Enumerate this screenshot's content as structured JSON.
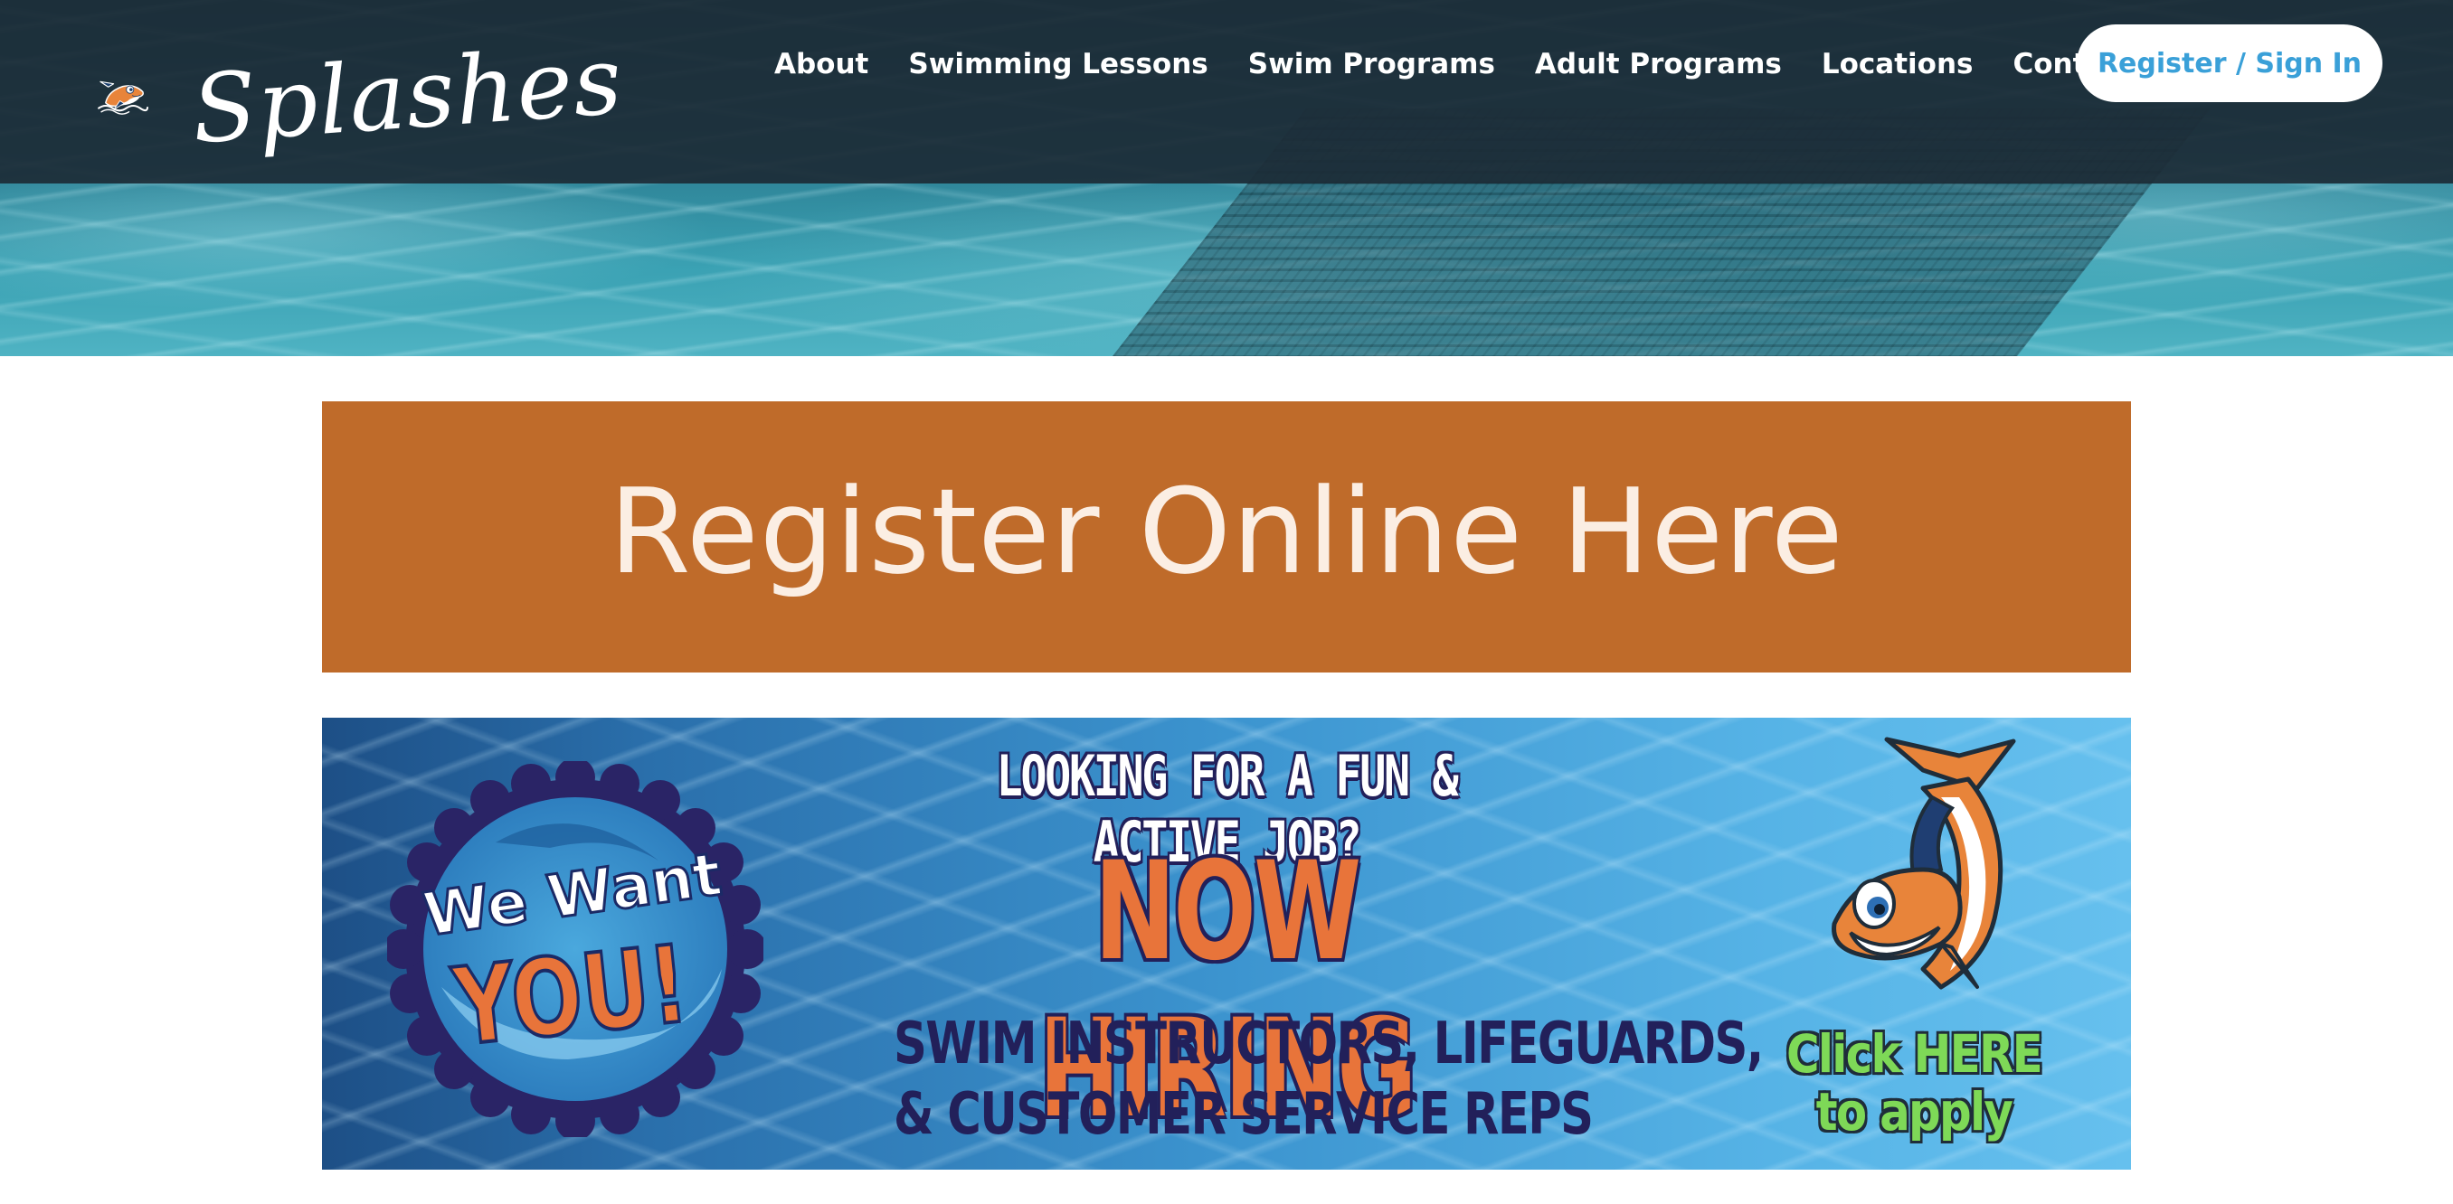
{
  "brand": {
    "name": "Splashes",
    "mascot_icon": "shark-mascot-icon"
  },
  "nav": {
    "items": [
      {
        "label": "About"
      },
      {
        "label": "Swimming Lessons"
      },
      {
        "label": "Swim Programs"
      },
      {
        "label": "Adult Programs"
      },
      {
        "label": "Locations"
      },
      {
        "label": "Contact Us"
      }
    ],
    "register_label": "Register / Sign In"
  },
  "register_banner": {
    "label": "Register Online Here",
    "color": "#bf6b2a"
  },
  "hiring_banner": {
    "badge_top": "We Want",
    "badge_bottom": "YOU!",
    "headline": "LOOKING FOR A FUN & ACTIVE JOB?",
    "title": "NOW HIRING",
    "roles_line1": "SWIM INSTRUCTORS, LIFEGUARDS,",
    "roles_line2": "& CUSTOMER SERVICE REPS",
    "cta_line1": "Click HERE",
    "cta_line2": "to apply",
    "accent_orange": "#e8743a",
    "accent_green": "#7ed957",
    "accent_navy": "#22205a"
  },
  "colors": {
    "header_bg": "#1c2b36",
    "link_blue": "#3aa0d8"
  }
}
